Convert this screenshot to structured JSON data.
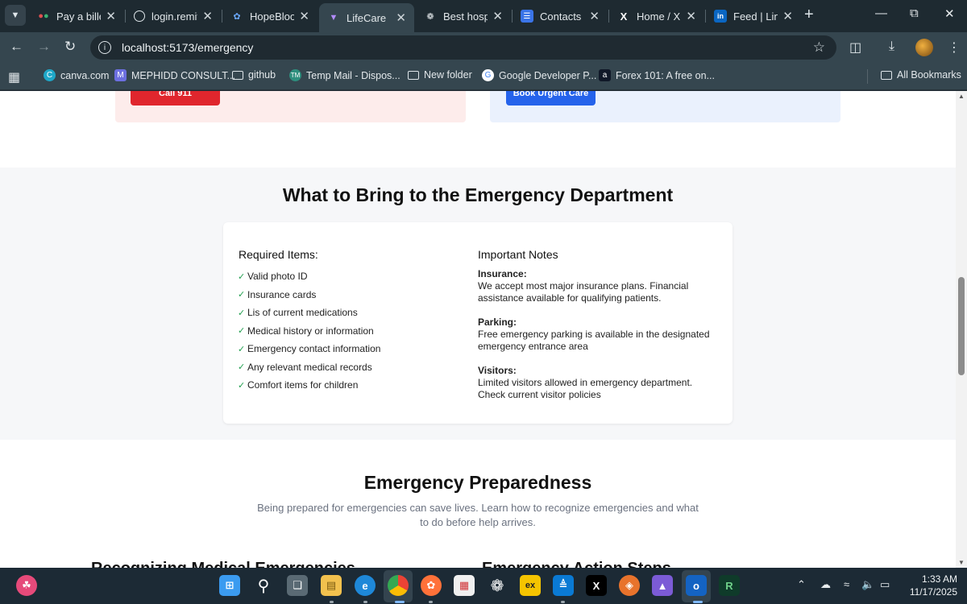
{
  "browser": {
    "tabs": [
      {
        "title": "Pay a biller",
        "favicon": "dots-icon"
      },
      {
        "title": "login.remit",
        "favicon": "globe-icon"
      },
      {
        "title": "HopeBloom",
        "favicon": "flower-icon"
      },
      {
        "title": "LifeCare",
        "favicon": "vite-icon",
        "active": true
      },
      {
        "title": "Best hospit",
        "favicon": "openai-icon"
      },
      {
        "title": "Contacts h",
        "favicon": "forms-icon"
      },
      {
        "title": "Home / X",
        "favicon": "x-icon"
      },
      {
        "title": "Feed | Link",
        "favicon": "linkedin-icon"
      }
    ],
    "url": "localhost:5173/emergency",
    "bookmarks": [
      {
        "label": "canva.com"
      },
      {
        "label": "MEPHIDD CONSULT..."
      },
      {
        "label": "github"
      },
      {
        "label": "Temp Mail - Dispos..."
      },
      {
        "label": "New folder"
      },
      {
        "label": "Google Developer P..."
      },
      {
        "label": "Forex 101: A free on..."
      }
    ],
    "all_bookmarks": "All Bookmarks"
  },
  "page": {
    "call_button": "Call 911",
    "book_button": "Book Urgent Care",
    "bring": {
      "title": "What to Bring to the Emergency Department",
      "required_title": "Required Items:",
      "required_items": [
        "Valid photo ID",
        "Insurance cards",
        "Lis of current medications",
        "Medical history or information",
        "Emergency contact information",
        "Any relevant medical records",
        "Comfort items for children"
      ],
      "notes_title": "Important Notes",
      "notes": [
        {
          "label": "Insurance:",
          "text": "We accept most major insurance plans. Financial assistance available for qualifying patients."
        },
        {
          "label": "Parking:",
          "text": "Free emergency parking is available in the designated emergency entrance area"
        },
        {
          "label": "Visitors:",
          "text": "Limited visitors allowed in emergency department. Check current visitor policies"
        }
      ]
    },
    "preparedness": {
      "title": "Emergency Preparedness",
      "text": "Being prepared for emergencies can save lives. Learn how to recognize emergencies and what to do before help arrives.",
      "peek_left": "Recognizing Medical Emergencies",
      "peek_right": "Emergency Action Steps"
    }
  },
  "taskbar": {
    "time": "1:33 AM",
    "date": "11/17/2025"
  },
  "colors": {
    "red_button": "#e0262d",
    "blue_button": "#2563eb",
    "check_green": "#22a050"
  }
}
